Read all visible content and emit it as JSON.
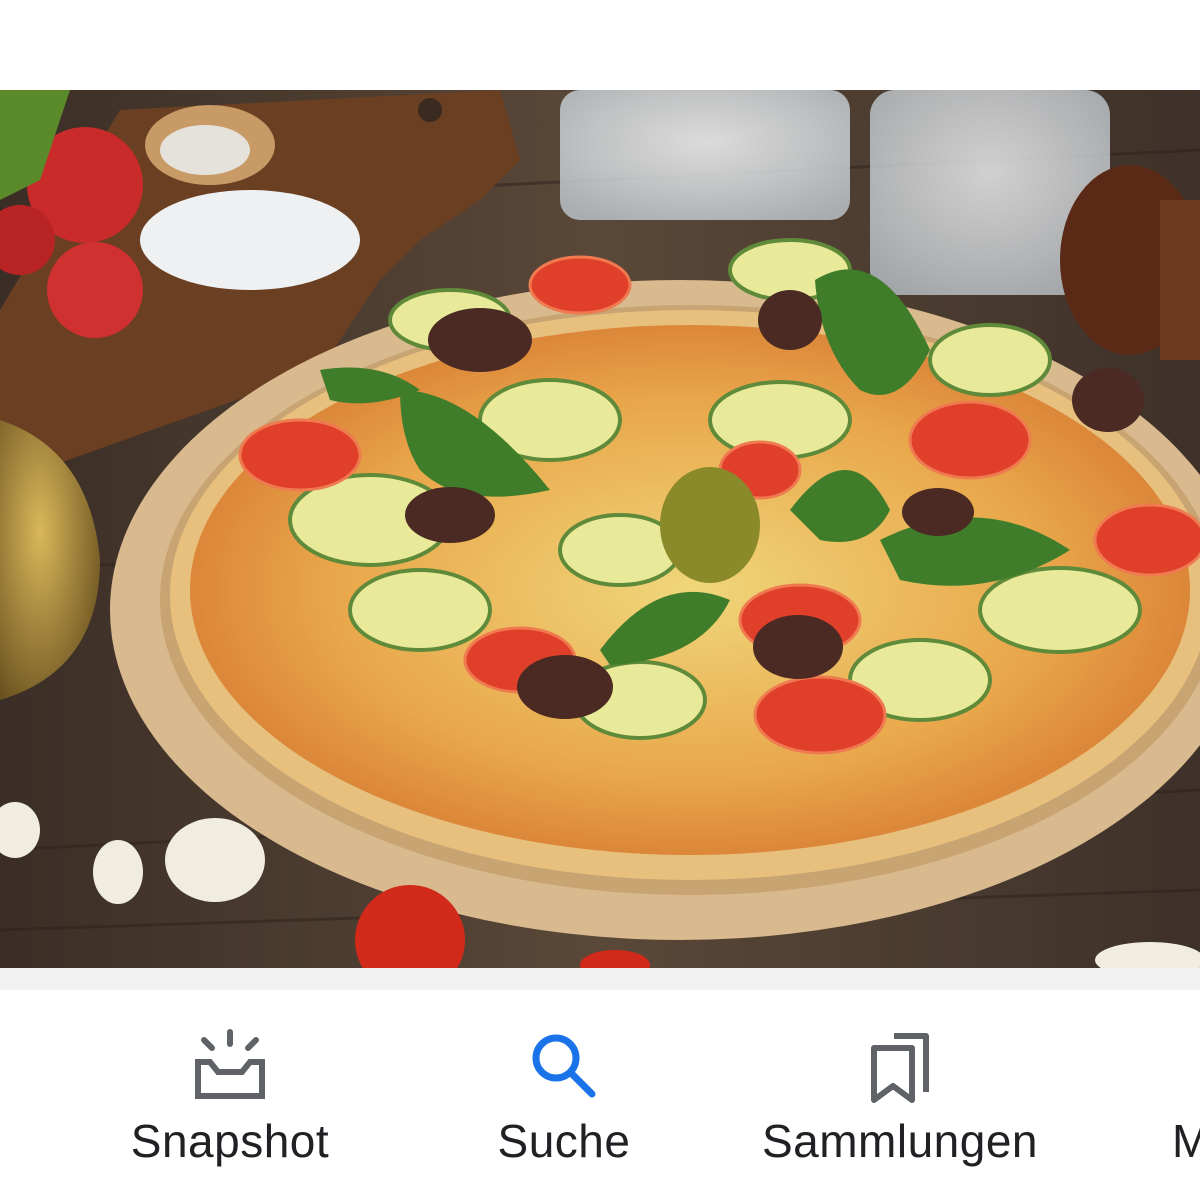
{
  "image": {
    "alt": "",
    "colors": {
      "table": "#5a4636",
      "plate": "#d9b98e",
      "crust": "#e9c37a",
      "sauce": "#e0602a",
      "basil": "#3f7d2a",
      "olive": "#4a2a22",
      "tomato": "#d23a22"
    }
  },
  "bottom_nav": {
    "items": [
      {
        "label": "Snapshot",
        "icon": "snapshot-icon",
        "active": false
      },
      {
        "label": "Suche",
        "icon": "search-icon",
        "active": true
      },
      {
        "label": "Sammlungen",
        "icon": "collections-icon",
        "active": false
      },
      {
        "label": "M",
        "icon": "more-icon",
        "active": false
      }
    ],
    "colors": {
      "active": "#1a73e8",
      "inactive": "#5f6368",
      "text": "#202124"
    }
  }
}
